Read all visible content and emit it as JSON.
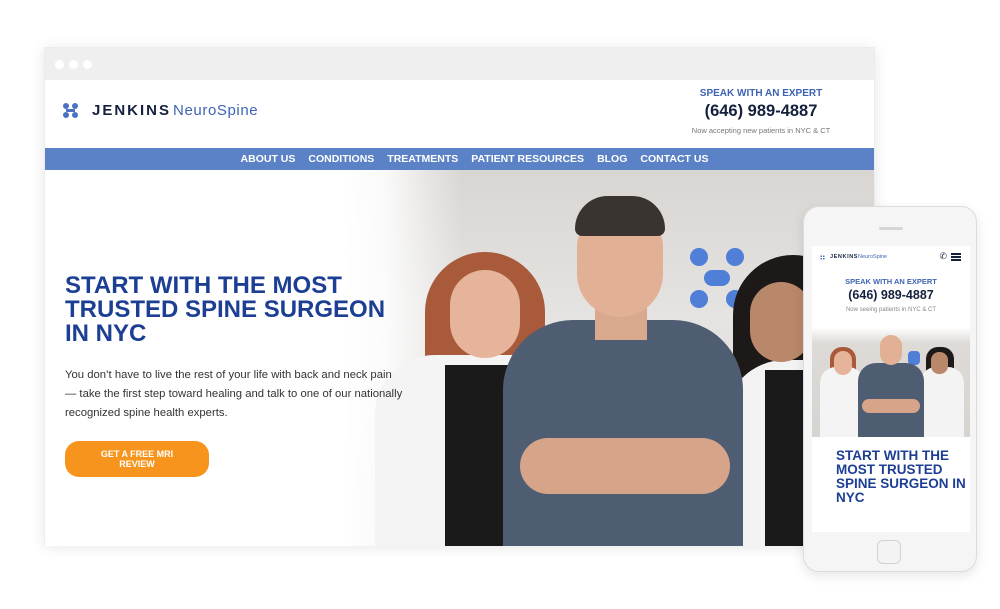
{
  "desktop": {
    "brand": {
      "name_bold": "JENKINS",
      "name_light": "NeuroSpine"
    },
    "header_cta": {
      "speak_label": "SPEAK WITH AN EXPERT",
      "phone": "(646) 989-4887",
      "note": "Now accepting new patients in NYC & CT"
    },
    "nav": {
      "items": [
        {
          "label": "ABOUT US"
        },
        {
          "label": "CONDITIONS"
        },
        {
          "label": "TREATMENTS"
        },
        {
          "label": "PATIENT RESOURCES"
        },
        {
          "label": "BLOG"
        },
        {
          "label": "CONTACT US"
        }
      ]
    },
    "hero": {
      "title": "START WITH THE MOST TRUSTED SPINE SURGEON IN NYC",
      "body": "You don’t have to live the rest of your life with back and neck pain — take the first step toward healing and talk to one of our nationally recognized spine health experts.",
      "cta_label": "GET A FREE MRI REVIEW",
      "image_alt": "Jenkins NeuroSpine medical team photo"
    }
  },
  "mobile": {
    "brand": {
      "name_bold": "JENKINS",
      "name_light": "NeuroSpine"
    },
    "icons": {
      "phone": "phone-icon",
      "menu": "hamburger-menu-icon"
    },
    "header_cta": {
      "speak_label": "SPEAK WITH AN EXPERT",
      "phone": "(646) 989-4887",
      "note": "Now seeing patients in NYC & CT"
    },
    "hero": {
      "title": "START WITH THE MOST TRUSTED SPINE SURGEON IN NYC"
    }
  },
  "colors": {
    "brand_blue": "#1c3f94",
    "nav_blue": "#5b82c6",
    "accent_blue": "#3d64b4",
    "cta_orange": "#f7941d",
    "dark_navy": "#14213d"
  }
}
